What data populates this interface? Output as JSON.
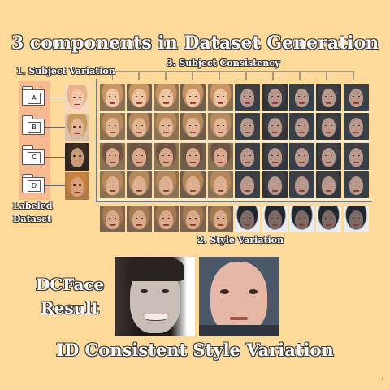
{
  "title": "3 components in Dataset Generation",
  "labels": {
    "subject_variation": "1. Subject Variation",
    "subject_consistency": "3. Subject Consistency",
    "style_variation": "2. Style Variation",
    "labeled_dataset": "Labeled Dataset"
  },
  "folders": [
    "A",
    "B",
    "C",
    "D"
  ],
  "result": {
    "label": "DCFace Result",
    "subtitle": "ID Consistent Style Variation"
  },
  "page_number": "1",
  "colors": {
    "background": "#fdd99a",
    "labeled_panel": "#f7b98f",
    "axis": "#6b7a87"
  }
}
